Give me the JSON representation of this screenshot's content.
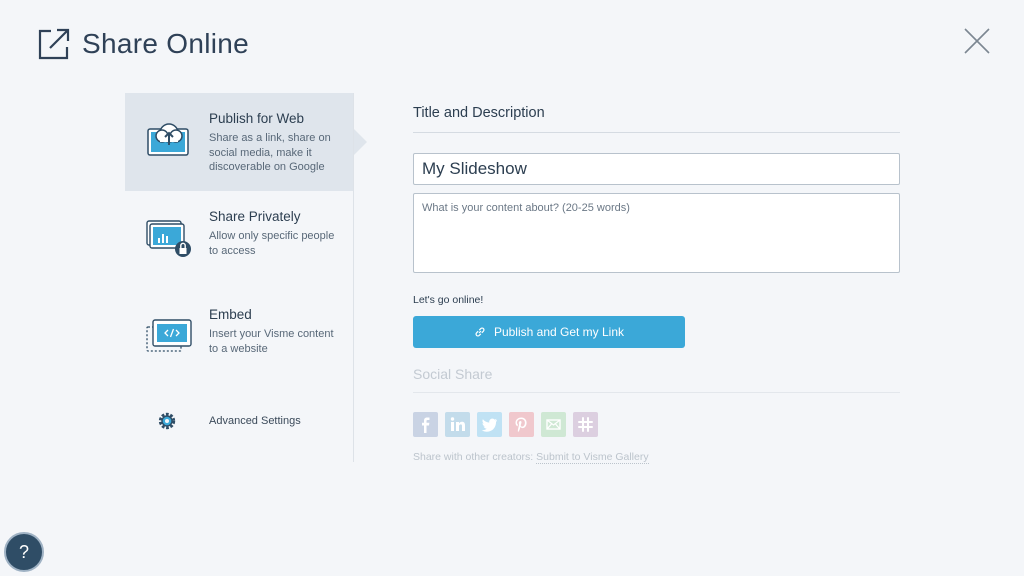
{
  "header": {
    "title": "Share Online",
    "icon": "external-share-icon"
  },
  "sidebar": {
    "items": [
      {
        "title": "Publish for Web",
        "desc": "Share as a link, share on social media, make it discoverable on Google",
        "icon": "cloud-upload-icon",
        "active": true
      },
      {
        "title": "Share Privately",
        "desc": "Allow only specific people to access",
        "icon": "lock-chart-icon",
        "active": false
      },
      {
        "title": "Embed",
        "desc": "Insert your Visme content to a website",
        "icon": "embed-code-icon",
        "active": false
      }
    ],
    "advanced": {
      "label": "Advanced Settings",
      "icon": "gear-icon"
    }
  },
  "main": {
    "section_title": "Title and Description",
    "title_value": "My Slideshow",
    "desc_placeholder": "What is your content about? (20-25 words)",
    "go_online": "Let's go online!",
    "publish_label": "Publish and Get my Link",
    "social_title": "Social Share",
    "social_icons": [
      "facebook-icon",
      "linkedin-icon",
      "twitter-icon",
      "pinterest-icon",
      "email-icon",
      "slack-icon"
    ],
    "gallery_prefix": "Share with other creators:",
    "gallery_link": "Submit to Visme Gallery"
  },
  "help": {
    "label": "?"
  },
  "colors": {
    "accent": "#3ba8d8",
    "active_bg": "#dfe5ec",
    "dark": "#2f4d66"
  }
}
